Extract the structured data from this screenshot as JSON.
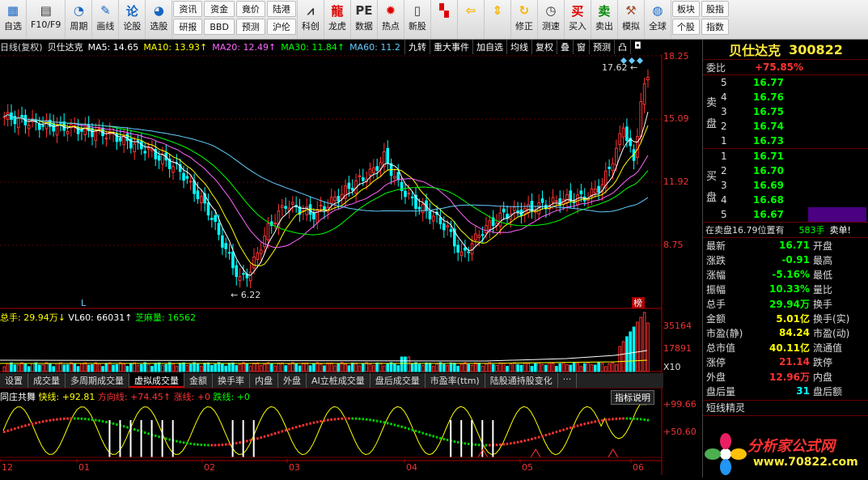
{
  "toolbar": {
    "buttons": [
      {
        "label": "自选",
        "icon": "grid-icon"
      },
      {
        "label": "F10/F9",
        "icon": "document-icon"
      },
      {
        "label": "周期",
        "icon": "clock-icon"
      },
      {
        "label": "画线",
        "icon": "pencil-icon"
      },
      {
        "label": "论股",
        "icon": "speech-icon"
      },
      {
        "label": "选股",
        "icon": "gauge-icon"
      }
    ],
    "grid1": [
      "资讯",
      "资金",
      "竟价",
      "陆港",
      "研报",
      "BBD",
      "预测",
      "沪伦"
    ],
    "buttons2": [
      {
        "label": "科创",
        "icon": "chart-icon"
      },
      {
        "label": "龙虎",
        "icon": "dragon-icon"
      },
      {
        "label": "数据",
        "icon": "pe-icon"
      },
      {
        "label": "热点",
        "icon": "hot-icon"
      },
      {
        "label": "新股",
        "icon": "ipo-icon"
      }
    ],
    "buttons3": [
      {
        "label": "",
        "icon": "color-grid-icon"
      },
      {
        "label": "",
        "icon": "back-arrow-icon"
      },
      {
        "label": "",
        "icon": "up-down-arrow-icon"
      },
      {
        "label": "修正",
        "icon": "refresh-icon"
      },
      {
        "label": "测速",
        "icon": "speed-clock-icon"
      }
    ],
    "buttons4": [
      {
        "label": "买入",
        "icon": "buy-icon",
        "char": "买"
      },
      {
        "label": "卖出",
        "icon": "sell-icon",
        "char": "卖"
      },
      {
        "label": "模拟",
        "icon": "hammer-icon"
      },
      {
        "label": "全球",
        "icon": "globe-icon"
      }
    ],
    "grid2": [
      "板块",
      "股指",
      "个股",
      "指数"
    ]
  },
  "chart_header": {
    "mode": "日线(复权)",
    "stock": "贝仕达克",
    "ma5": "MA5: 14.65",
    "ma10": "MA10: 13.93↑",
    "ma20": "MA20: 12.49↑",
    "ma30": "MA30: 11.84↑",
    "ma60": "MA60: 11.2"
  },
  "chart_tools": [
    "九转",
    "重大事件",
    "加自选",
    "均线",
    "复权",
    "叠",
    "窗",
    "预测",
    "凸",
    "◘"
  ],
  "price_axis": [
    "18.25",
    "15.09",
    "11.92",
    "8.75"
  ],
  "volume_axis": [
    "35164",
    "17891",
    "X10"
  ],
  "indicator_axis": [
    "+99.66",
    "+50.60"
  ],
  "annotations": {
    "high": "17.62",
    "low": "6.22",
    "bang": "榜",
    "L": "L"
  },
  "volume_header": {
    "total": "总手: 29.94万↓",
    "vl60": "VL60: 66031↑",
    "zmcl": "芝麻量: 16562"
  },
  "tabs": [
    "设置",
    "成交量",
    "多周期成交量",
    "虚拟成交量",
    "金额",
    "换手率",
    "内盘",
    "外盘",
    "AI立桩成交量",
    "盘后成交量",
    "市盈率(ttm)",
    "陆股通持股变化",
    "···"
  ],
  "active_tab": 3,
  "indicator_header": {
    "name": "同庄共舞",
    "fast": "快线: +92.81",
    "dir": "方向线: +74.45↑",
    "up": "涨线: +0",
    "down": "跌线: +0",
    "help": "指标说明"
  },
  "x_axis": [
    "12",
    "01",
    "02",
    "03",
    "04",
    "05",
    "06"
  ],
  "right_panel": {
    "title": "贝仕达克",
    "code": "300822",
    "weibi_lbl": "委比",
    "weibi": "+75.85%",
    "sell_lbl": "卖盘",
    "buy_lbl": "买盘",
    "asks": [
      {
        "lv": "5",
        "p": "16.77"
      },
      {
        "lv": "4",
        "p": "16.76"
      },
      {
        "lv": "3",
        "p": "16.75"
      },
      {
        "lv": "2",
        "p": "16.74"
      },
      {
        "lv": "1",
        "p": "16.73"
      }
    ],
    "bids": [
      {
        "lv": "1",
        "p": "16.71"
      },
      {
        "lv": "2",
        "p": "16.70"
      },
      {
        "lv": "3",
        "p": "16.69"
      },
      {
        "lv": "4",
        "p": "16.68"
      },
      {
        "lv": "5",
        "p": "16.67"
      }
    ],
    "notice_a": "在卖盘16.79位置有",
    "notice_b": "583手",
    "notice_c": "卖单!",
    "quotes": [
      {
        "l": "最新",
        "v": "16.71",
        "c": "#0f0",
        "l2": "开盘"
      },
      {
        "l": "涨跌",
        "v": "-0.91",
        "c": "#0f0",
        "l2": "最高"
      },
      {
        "l": "涨幅",
        "v": "-5.16%",
        "c": "#0f0",
        "l2": "最低"
      },
      {
        "l": "振幅",
        "v": "10.33%",
        "c": "#0f0",
        "l2": "量比"
      },
      {
        "l": "总手",
        "v": "29.94万",
        "c": "#0f0",
        "l2": "换手"
      },
      {
        "l": "金额",
        "v": "5.01亿",
        "c": "#ff0",
        "l2": "换手(实)"
      },
      {
        "l": "市盈(静)",
        "v": "84.24",
        "c": "#ff0",
        "l2": "市盈(动)"
      },
      {
        "l": "总市值",
        "v": "40.11亿",
        "c": "#ff0",
        "l2": "流通值"
      },
      {
        "l": "涨停",
        "v": "21.14",
        "c": "#f33",
        "l2": "跌停"
      },
      {
        "l": "外盘",
        "v": "12.96万",
        "c": "#f33",
        "l2": "内盘"
      },
      {
        "l": "盘后量",
        "v": "31",
        "c": "#0ff",
        "l2": "盘后额"
      }
    ],
    "short_lbl": "短线精灵",
    "logo_text": "分析家公式网",
    "logo_url": "www.70822.com"
  },
  "colors": {
    "up": "#ff3333",
    "down": "#00ffff",
    "ma5": "#ffffff",
    "ma10": "#ffff00",
    "ma20": "#ff66ff",
    "ma30": "#00ff00",
    "ma60": "#66ccff"
  }
}
